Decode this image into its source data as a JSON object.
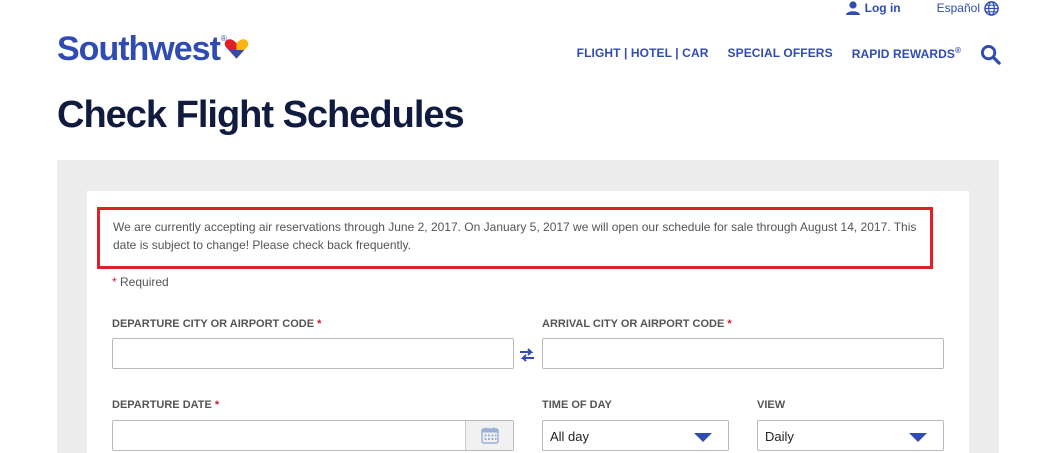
{
  "header": {
    "login_label": "Log in",
    "language_label": "Español",
    "logo_text": "Southwest",
    "logo_reg": "®",
    "nav": {
      "flight_hotel_car": "FLIGHT | HOTEL | CAR",
      "special_offers": "SPECIAL OFFERS",
      "rapid_rewards": "RAPID REWARDS",
      "rapid_rewards_reg": "®"
    },
    "icons": [
      "user-icon",
      "globe-icon",
      "heart-logo-icon",
      "search-icon"
    ]
  },
  "page_title": "Check Flight Schedules",
  "notice": "We are currently accepting air reservations through June 2, 2017. On January 5, 2017 we will open our schedule for sale through August 14, 2017. This date is subject to change! Please check back frequently.",
  "form": {
    "required_star": "*",
    "required_label": " Required",
    "departure_label": "DEPARTURE CITY OR AIRPORT CODE",
    "departure_value": "",
    "arrival_label": "ARRIVAL CITY OR AIRPORT CODE",
    "arrival_value": "",
    "departure_date_label": "DEPARTURE DATE",
    "departure_date_value": "",
    "time_of_day_label": "TIME OF DAY",
    "time_of_day_value": "All day",
    "view_label": "VIEW",
    "view_value": "Daily",
    "star": "*"
  },
  "colors": {
    "brand_blue": "#304cb2",
    "title_navy": "#111b40",
    "highlight_red": "#e01f27",
    "required_red": "#d5152e",
    "panel_gray": "#ececec"
  }
}
